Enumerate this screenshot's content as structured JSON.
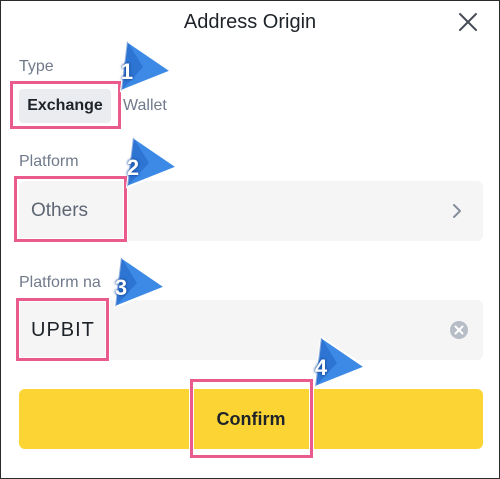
{
  "dialog": {
    "title": "Address Origin",
    "close_icon": "close-icon"
  },
  "type_section": {
    "label": "Type",
    "options": [
      {
        "label": "Exchange",
        "selected": true
      },
      {
        "label": "Wallet",
        "selected": false
      }
    ]
  },
  "platform_section": {
    "label": "Platform",
    "value": "Others",
    "icon": "chevron-right-icon"
  },
  "platform_name_section": {
    "label": "Platform na",
    "value": "UPBIT",
    "icon": "clear-icon"
  },
  "confirm_label": "Confirm",
  "annotations": {
    "markers": [
      "1",
      "2",
      "3",
      "4"
    ],
    "highlight_color": "#e85b8c",
    "marker_color": "#3d8ae6"
  },
  "colors": {
    "accent": "#fcd535",
    "field_bg": "#f5f5f5",
    "selected_bg": "#eaecef",
    "muted_text": "#707a8a"
  }
}
